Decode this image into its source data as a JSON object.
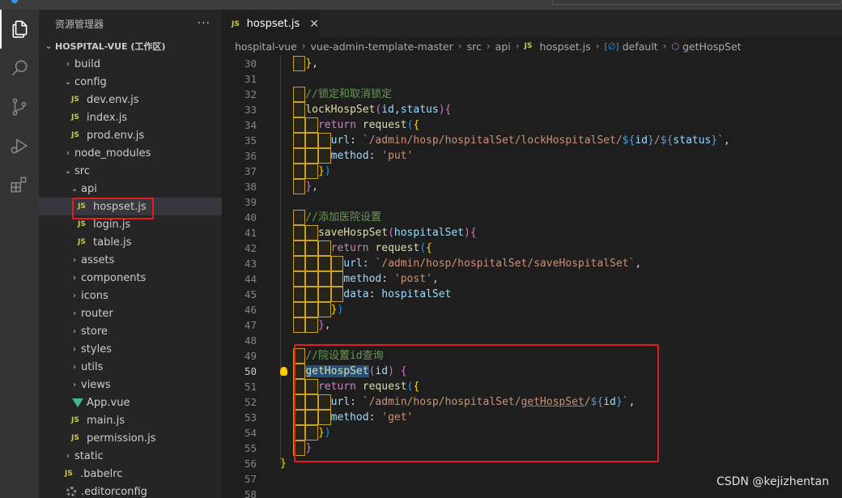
{
  "sidebar": {
    "title": "资源管理器",
    "more": "···",
    "root_label": "HOSPITAL-VUE (工作区)",
    "items": [
      {
        "label": "build",
        "kind": "folder",
        "open": false,
        "depth": 1
      },
      {
        "label": "config",
        "kind": "folder",
        "open": true,
        "depth": 1
      },
      {
        "label": "dev.env.js",
        "kind": "js",
        "depth": 2
      },
      {
        "label": "index.js",
        "kind": "js",
        "depth": 2
      },
      {
        "label": "prod.env.js",
        "kind": "js",
        "depth": 2
      },
      {
        "label": "node_modules",
        "kind": "folder",
        "open": false,
        "depth": 1
      },
      {
        "label": "src",
        "kind": "folder",
        "open": true,
        "depth": 1
      },
      {
        "label": "api",
        "kind": "folder",
        "open": true,
        "depth": 2
      },
      {
        "label": "hospset.js",
        "kind": "js",
        "depth": 3,
        "selected": true
      },
      {
        "label": "login.js",
        "kind": "js",
        "depth": 3
      },
      {
        "label": "table.js",
        "kind": "js",
        "depth": 3
      },
      {
        "label": "assets",
        "kind": "folder",
        "open": false,
        "depth": 2
      },
      {
        "label": "components",
        "kind": "folder",
        "open": false,
        "depth": 2
      },
      {
        "label": "icons",
        "kind": "folder",
        "open": false,
        "depth": 2
      },
      {
        "label": "router",
        "kind": "folder",
        "open": false,
        "depth": 2
      },
      {
        "label": "store",
        "kind": "folder",
        "open": false,
        "depth": 2
      },
      {
        "label": "styles",
        "kind": "folder",
        "open": false,
        "depth": 2
      },
      {
        "label": "utils",
        "kind": "folder",
        "open": false,
        "depth": 2
      },
      {
        "label": "views",
        "kind": "folder",
        "open": false,
        "depth": 2
      },
      {
        "label": "App.vue",
        "kind": "vue",
        "depth": 2
      },
      {
        "label": "main.js",
        "kind": "js",
        "depth": 2
      },
      {
        "label": "permission.js",
        "kind": "js",
        "depth": 2
      },
      {
        "label": "static",
        "kind": "folder",
        "open": false,
        "depth": 1
      },
      {
        "label": ".babelrc",
        "kind": "js",
        "depth": 1
      },
      {
        "label": ".editorconfig",
        "kind": "gear",
        "depth": 1
      }
    ]
  },
  "badges": {
    "js": "JS"
  },
  "tab": {
    "label": "hospset.js",
    "close": "✕"
  },
  "breadcrumb": {
    "parts": [
      "hospital-vue",
      "vue-admin-template-master",
      "src",
      "api",
      "hospset.js",
      "default",
      "getHospSet"
    ]
  },
  "editor": {
    "current_line": 50,
    "lines": [
      {
        "n": 30,
        "tokens": [
          [
            "p",
            "    "
          ],
          [
            "b1",
            "}"
          ],
          [
            "p",
            ","
          ]
        ]
      },
      {
        "n": 31,
        "tokens": []
      },
      {
        "n": 32,
        "tokens": [
          [
            "p",
            "    "
          ],
          [
            "c",
            "//锁定和取消锁定"
          ]
        ]
      },
      {
        "n": 33,
        "tokens": [
          [
            "p",
            "    "
          ],
          [
            "f",
            "lockHospSet"
          ],
          [
            "b2",
            "("
          ],
          [
            "v",
            "id"
          ],
          [
            "p",
            ","
          ],
          [
            "v",
            "status"
          ],
          [
            "b2",
            ")"
          ],
          [
            "b2",
            "{"
          ]
        ]
      },
      {
        "n": 34,
        "tokens": [
          [
            "p",
            "      "
          ],
          [
            "k",
            "return"
          ],
          [
            "p",
            " "
          ],
          [
            "f",
            "request"
          ],
          [
            "b3",
            "("
          ],
          [
            "b1",
            "{"
          ]
        ]
      },
      {
        "n": 35,
        "tokens": [
          [
            "p",
            "        "
          ],
          [
            "v",
            "url"
          ],
          [
            "p",
            ": "
          ],
          [
            "s",
            "`/admin/hosp/hospitalSet/lockHospitalSet/"
          ],
          [
            "e",
            "${"
          ],
          [
            "v",
            "id"
          ],
          [
            "e",
            "}"
          ],
          [
            "s",
            "/"
          ],
          [
            "e",
            "${"
          ],
          [
            "v",
            "status"
          ],
          [
            "e",
            "}"
          ],
          [
            "s",
            "`"
          ],
          [
            "p",
            ","
          ]
        ]
      },
      {
        "n": 36,
        "tokens": [
          [
            "p",
            "        "
          ],
          [
            "v",
            "method"
          ],
          [
            "p",
            ": "
          ],
          [
            "s",
            "'put'"
          ]
        ]
      },
      {
        "n": 37,
        "tokens": [
          [
            "p",
            "      "
          ],
          [
            "b1",
            "}"
          ],
          [
            "b3",
            ")"
          ]
        ]
      },
      {
        "n": 38,
        "tokens": [
          [
            "p",
            "    "
          ],
          [
            "b2",
            "}"
          ],
          [
            "p",
            ","
          ]
        ]
      },
      {
        "n": 39,
        "tokens": []
      },
      {
        "n": 40,
        "tokens": [
          [
            "p",
            "    "
          ],
          [
            "c",
            "//添加医院设置"
          ]
        ]
      },
      {
        "n": 41,
        "tokens": [
          [
            "p",
            "      "
          ],
          [
            "f",
            "saveHospSet"
          ],
          [
            "b2",
            "("
          ],
          [
            "v",
            "hospitalSet"
          ],
          [
            "b2",
            ")"
          ],
          [
            "b2",
            "{"
          ]
        ]
      },
      {
        "n": 42,
        "tokens": [
          [
            "p",
            "        "
          ],
          [
            "k",
            "return"
          ],
          [
            "p",
            " "
          ],
          [
            "f",
            "request"
          ],
          [
            "b3",
            "("
          ],
          [
            "b1",
            "{"
          ]
        ]
      },
      {
        "n": 43,
        "tokens": [
          [
            "p",
            "          "
          ],
          [
            "v",
            "url"
          ],
          [
            "p",
            ": "
          ],
          [
            "s",
            "`/admin/hosp/hospitalSet/saveHospitalSet`"
          ],
          [
            "p",
            ","
          ]
        ]
      },
      {
        "n": 44,
        "tokens": [
          [
            "p",
            "          "
          ],
          [
            "v",
            "method"
          ],
          [
            "p",
            ": "
          ],
          [
            "s",
            "'post'"
          ],
          [
            "p",
            ","
          ]
        ]
      },
      {
        "n": 45,
        "tokens": [
          [
            "p",
            "          "
          ],
          [
            "v",
            "data"
          ],
          [
            "p",
            ": "
          ],
          [
            "v",
            "hospitalSet"
          ]
        ]
      },
      {
        "n": 46,
        "tokens": [
          [
            "p",
            "        "
          ],
          [
            "b1",
            "}"
          ],
          [
            "b3",
            ")"
          ]
        ]
      },
      {
        "n": 47,
        "tokens": [
          [
            "p",
            "      "
          ],
          [
            "b2",
            "}"
          ],
          [
            "p",
            ","
          ]
        ]
      },
      {
        "n": 48,
        "tokens": []
      },
      {
        "n": 49,
        "tokens": [
          [
            "p",
            "    "
          ],
          [
            "c",
            "//院设置id查询"
          ]
        ]
      },
      {
        "n": 50,
        "tokens": [
          [
            "p",
            "    "
          ],
          [
            "fsel",
            "getHospSet"
          ],
          [
            "b2",
            "("
          ],
          [
            "v",
            "id"
          ],
          [
            "b2",
            ")"
          ],
          [
            "p",
            " "
          ],
          [
            "b2",
            "{"
          ]
        ]
      },
      {
        "n": 51,
        "tokens": [
          [
            "p",
            "      "
          ],
          [
            "k",
            "return"
          ],
          [
            "p",
            " "
          ],
          [
            "f",
            "request"
          ],
          [
            "b3",
            "("
          ],
          [
            "b1",
            "{"
          ]
        ]
      },
      {
        "n": 52,
        "tokens": [
          [
            "p",
            "        "
          ],
          [
            "v",
            "url"
          ],
          [
            "p",
            ": "
          ],
          [
            "s",
            "`/admin/hosp/hospitalSet/"
          ],
          [
            "sul",
            "getHospSet"
          ],
          [
            "s",
            "/"
          ],
          [
            "e",
            "${"
          ],
          [
            "v",
            "id"
          ],
          [
            "e",
            "}"
          ],
          [
            "s",
            "`"
          ],
          [
            "p",
            ","
          ]
        ]
      },
      {
        "n": 53,
        "tokens": [
          [
            "p",
            "        "
          ],
          [
            "v",
            "method"
          ],
          [
            "p",
            ": "
          ],
          [
            "s",
            "'get'"
          ]
        ]
      },
      {
        "n": 54,
        "tokens": [
          [
            "p",
            "      "
          ],
          [
            "b1",
            "}"
          ],
          [
            "b3",
            ")"
          ]
        ]
      },
      {
        "n": 55,
        "tokens": [
          [
            "p",
            "    "
          ],
          [
            "b2",
            "}"
          ]
        ]
      },
      {
        "n": 56,
        "tokens": [
          [
            "b1",
            "}"
          ]
        ]
      },
      {
        "n": 57,
        "tokens": []
      },
      {
        "n": 58,
        "tokens": []
      }
    ]
  },
  "watermark": "CSDN @kejizhentan",
  "colors": {
    "highlight": "#e51c1c",
    "accent": "#3794ff"
  }
}
